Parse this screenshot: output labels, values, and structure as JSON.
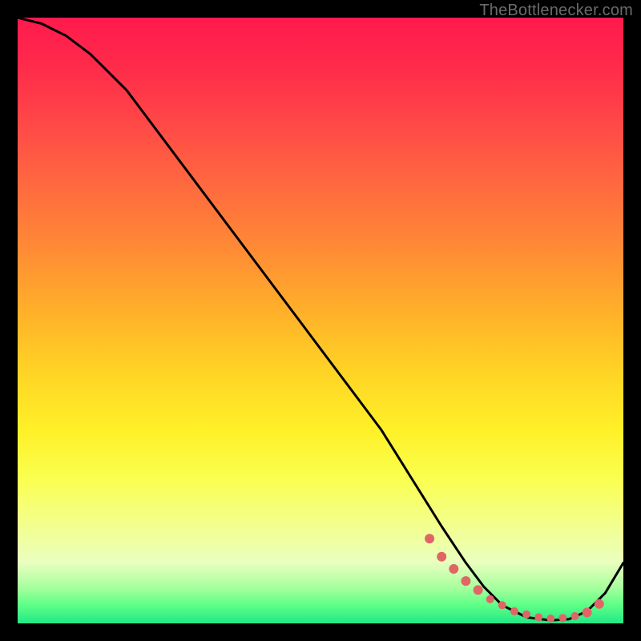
{
  "watermark": "TheBottlenecker.com",
  "chart_data": {
    "type": "line",
    "title": "",
    "xlabel": "",
    "ylabel": "",
    "xlim": [
      0,
      100
    ],
    "ylim": [
      0,
      100
    ],
    "series": [
      {
        "name": "bottleneck-curve",
        "x": [
          0,
          4,
          8,
          12,
          18,
          30,
          45,
          60,
          70,
          74,
          77,
          80,
          84,
          88,
          91,
          94,
          97,
          100
        ],
        "values": [
          100,
          99,
          97,
          94,
          88,
          72,
          52,
          32,
          16,
          10,
          6,
          3,
          1,
          0.5,
          0.7,
          2,
          5,
          10
        ]
      }
    ],
    "markers": {
      "name": "highlight-points",
      "color": "#e06666",
      "x": [
        68,
        70,
        72,
        74,
        76,
        78,
        80,
        82,
        84,
        86,
        88,
        90,
        92,
        94,
        96
      ],
      "values": [
        14,
        11,
        9,
        7,
        5.5,
        4,
        3,
        2,
        1.5,
        1,
        0.8,
        0.9,
        1.2,
        1.8,
        3.2
      ],
      "radius": [
        6,
        6,
        6,
        6,
        6,
        5,
        5,
        5,
        5,
        5,
        5,
        5,
        5,
        6,
        6
      ]
    }
  }
}
